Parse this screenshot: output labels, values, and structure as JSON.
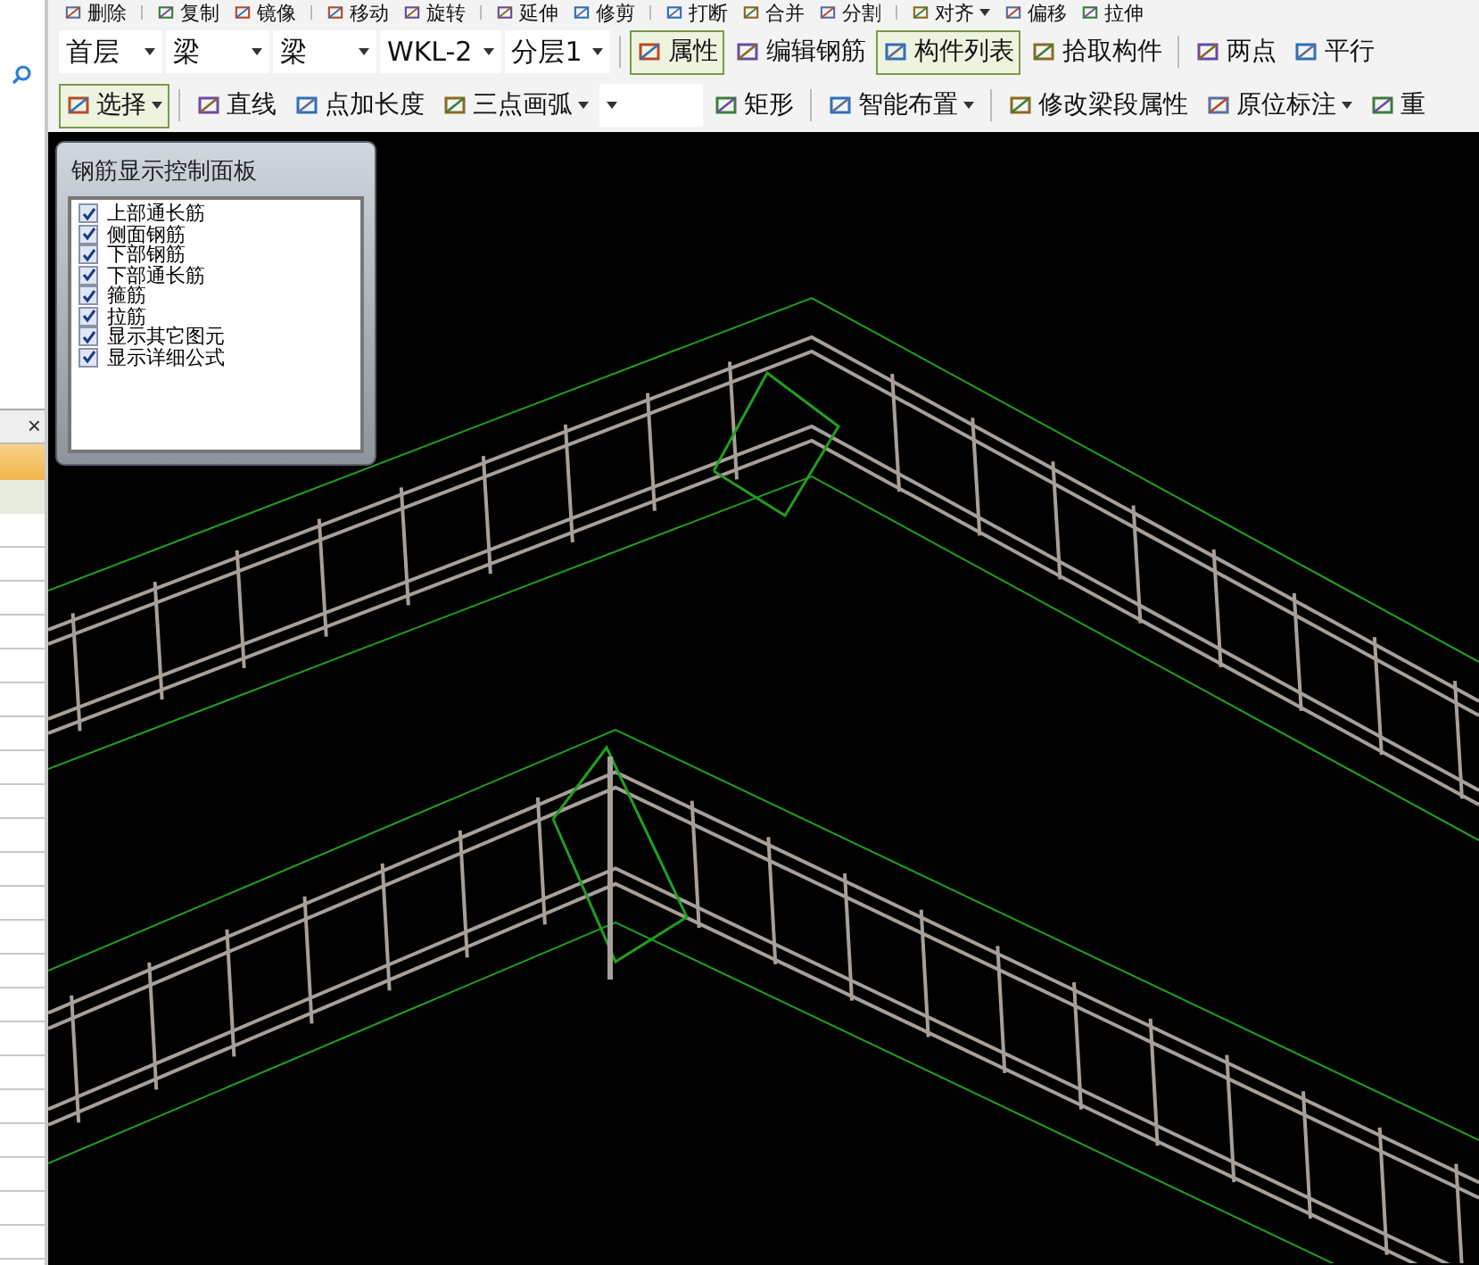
{
  "edit_toolbar": {
    "groups": [
      [
        {
          "kind": "button",
          "label": "删除",
          "selected": false,
          "has_menu": false
        }
      ],
      [
        {
          "kind": "button",
          "label": "复制",
          "selected": false,
          "has_menu": false
        },
        {
          "kind": "button",
          "label": "镜像",
          "selected": false,
          "has_menu": false
        }
      ],
      [
        {
          "kind": "button",
          "label": "移动",
          "selected": false,
          "has_menu": false
        },
        {
          "kind": "button",
          "label": "旋转",
          "selected": false,
          "has_menu": false
        }
      ],
      [
        {
          "kind": "button",
          "label": "延伸",
          "selected": false,
          "has_menu": false
        },
        {
          "kind": "button",
          "label": "修剪",
          "selected": false,
          "has_menu": false
        }
      ],
      [
        {
          "kind": "button",
          "label": "打断",
          "selected": false,
          "has_menu": false
        },
        {
          "kind": "button",
          "label": "合并",
          "selected": false,
          "has_menu": false
        },
        {
          "kind": "button",
          "label": "分割",
          "selected": false,
          "has_menu": false
        }
      ],
      [
        {
          "kind": "button",
          "label": "对齐",
          "selected": false,
          "has_menu": true
        },
        {
          "kind": "button",
          "label": "偏移",
          "selected": false,
          "has_menu": false
        },
        {
          "kind": "button",
          "label": "拉伸",
          "selected": false,
          "has_menu": false
        }
      ]
    ]
  },
  "element_toolbar": {
    "groups": [
      [
        {
          "kind": "combo",
          "value": "首层"
        },
        {
          "kind": "combo",
          "value": "梁"
        },
        {
          "kind": "combo",
          "value": "梁"
        },
        {
          "kind": "combo",
          "value": "WKL-2"
        },
        {
          "kind": "combo",
          "value": "分层1"
        }
      ],
      [
        {
          "kind": "button",
          "label": "属性",
          "selected": true,
          "has_menu": false
        },
        {
          "kind": "button",
          "label": "编辑钢筋",
          "selected": false,
          "has_menu": false
        },
        {
          "kind": "button",
          "label": "构件列表",
          "selected": true,
          "has_menu": false
        },
        {
          "kind": "button",
          "label": "拾取构件",
          "selected": false,
          "has_menu": false
        }
      ],
      [
        {
          "kind": "button",
          "label": "两点",
          "selected": false,
          "has_menu": false
        },
        {
          "kind": "button",
          "label": "平行",
          "selected": false,
          "has_menu": false
        }
      ]
    ]
  },
  "draw_toolbar": {
    "groups": [
      [
        {
          "kind": "button",
          "label": "选择",
          "selected": true,
          "has_menu": true
        }
      ],
      [
        {
          "kind": "button",
          "label": "直线",
          "selected": false,
          "has_menu": false
        },
        {
          "kind": "button",
          "label": "点加长度",
          "selected": false,
          "has_menu": false
        },
        {
          "kind": "button",
          "label": "三点画弧",
          "selected": false,
          "has_menu": true
        },
        {
          "kind": "combo"
        },
        {
          "kind": "button",
          "label": "矩形",
          "selected": false,
          "has_menu": false
        }
      ],
      [
        {
          "kind": "button",
          "label": "智能布置",
          "selected": false,
          "has_menu": true
        }
      ],
      [
        {
          "kind": "button",
          "label": "修改梁段属性",
          "selected": false,
          "has_menu": false
        },
        {
          "kind": "button",
          "label": "原位标注",
          "selected": false,
          "has_menu": true
        },
        {
          "kind": "button",
          "label": "重",
          "selected": false,
          "has_menu": false
        }
      ]
    ]
  },
  "side_panel": {
    "close": "×"
  },
  "rebar_panel": {
    "title": "钢筋显示控制面板",
    "items": [
      {
        "label": "上部通长筋",
        "checked": true
      },
      {
        "label": "侧面钢筋",
        "checked": true
      },
      {
        "label": "下部钢筋",
        "checked": true
      },
      {
        "label": "下部通长筋",
        "checked": true
      },
      {
        "label": "箍筋",
        "checked": true
      },
      {
        "label": "拉筋",
        "checked": true
      },
      {
        "label": "显示其它图元",
        "checked": true
      },
      {
        "label": "显示详细公式",
        "checked": true
      }
    ]
  }
}
